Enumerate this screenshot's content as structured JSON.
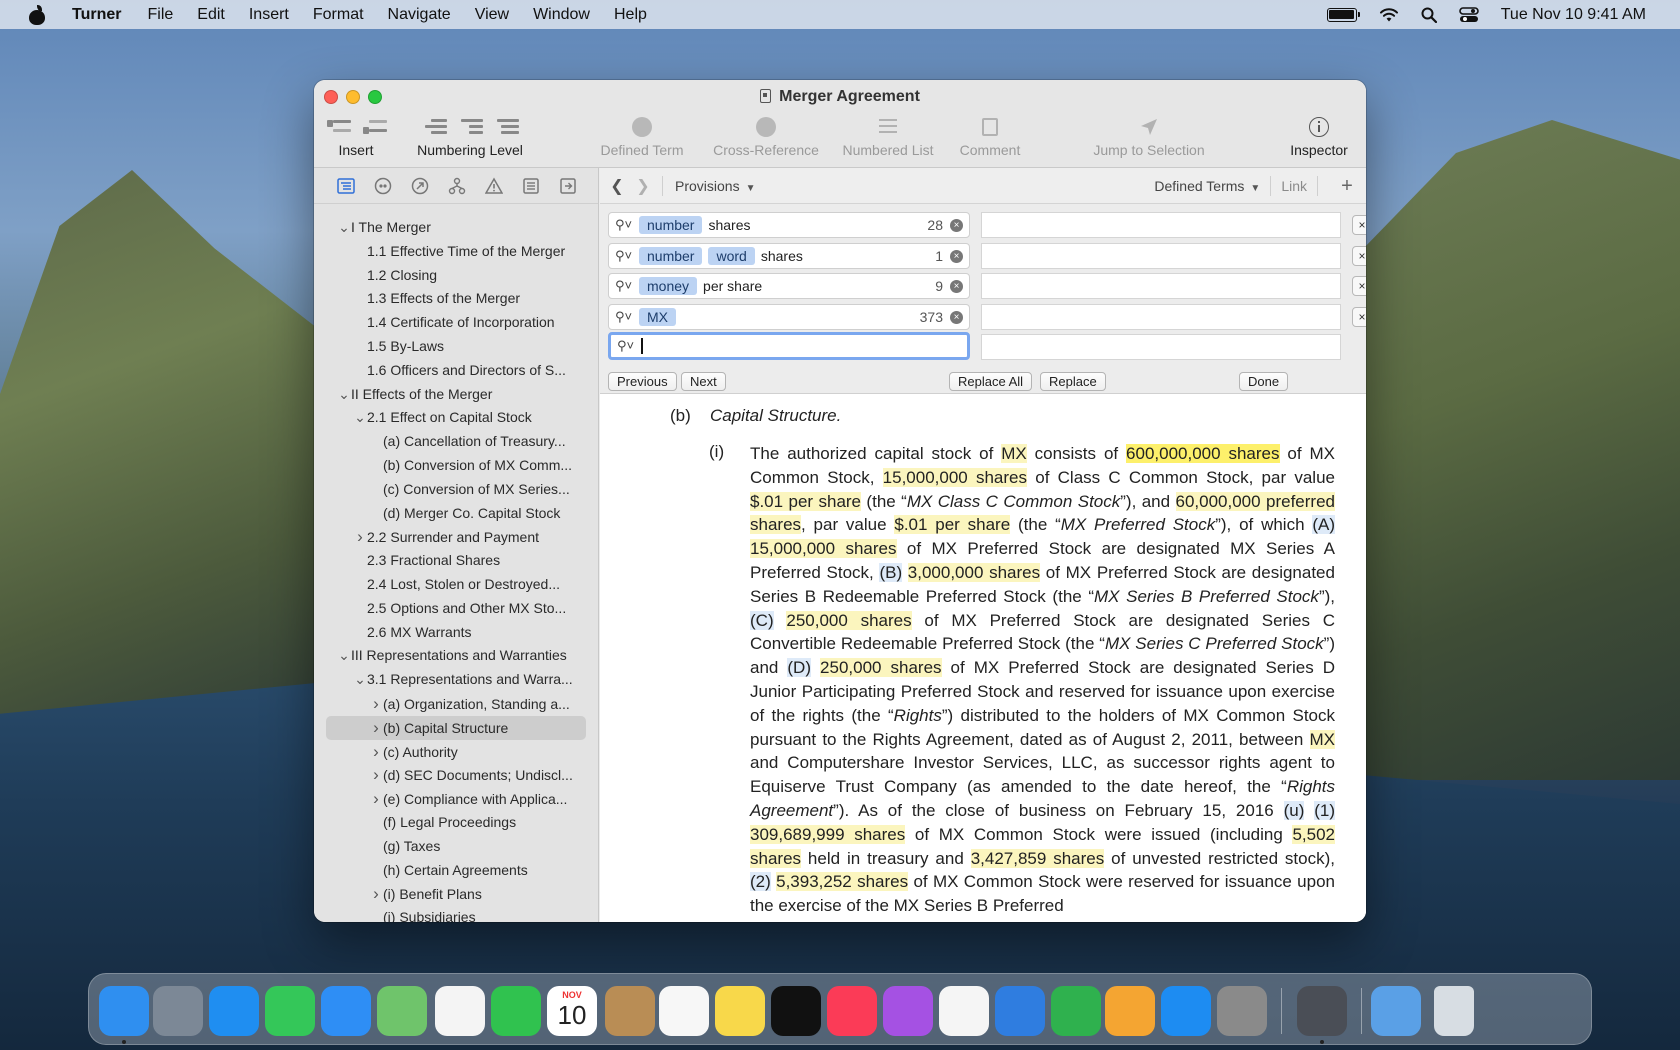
{
  "menubar": {
    "app_name": "Turner",
    "items": [
      "File",
      "Edit",
      "Insert",
      "Format",
      "Navigate",
      "View",
      "Window",
      "Help"
    ],
    "clock": "Tue Nov 10  9:41 AM"
  },
  "window": {
    "title": "Merger Agreement"
  },
  "toolbar": {
    "insert": "Insert",
    "numbering_level": "Numbering Level",
    "defined_term": "Defined Term",
    "cross_reference": "Cross-Reference",
    "numbered_list": "Numbered List",
    "comment": "Comment",
    "jump_to_selection": "Jump to Selection",
    "inspector": "Inspector"
  },
  "outline": [
    {
      "label": "I The Merger",
      "indent": 0,
      "disclosure": "open"
    },
    {
      "label": "1.1 Effective Time of the Merger",
      "indent": 1,
      "disclosure": "none"
    },
    {
      "label": "1.2 Closing",
      "indent": 1,
      "disclosure": "none"
    },
    {
      "label": "1.3 Effects of the Merger",
      "indent": 1,
      "disclosure": "none"
    },
    {
      "label": "1.4 Certificate of Incorporation",
      "indent": 1,
      "disclosure": "none"
    },
    {
      "label": "1.5 By-Laws",
      "indent": 1,
      "disclosure": "none"
    },
    {
      "label": "1.6 Officers and Directors of S...",
      "indent": 1,
      "disclosure": "none"
    },
    {
      "label": "II Effects of the Merger",
      "indent": 0,
      "disclosure": "open"
    },
    {
      "label": "2.1 Effect on Capital Stock",
      "indent": 1,
      "disclosure": "open"
    },
    {
      "label": "(a) Cancellation of Treasury...",
      "indent": 2,
      "disclosure": "none"
    },
    {
      "label": "(b) Conversion of MX Comm...",
      "indent": 2,
      "disclosure": "none"
    },
    {
      "label": "(c) Conversion of MX Series...",
      "indent": 2,
      "disclosure": "none"
    },
    {
      "label": "(d) Merger Co. Capital Stock",
      "indent": 2,
      "disclosure": "none"
    },
    {
      "label": "2.2 Surrender and Payment",
      "indent": 1,
      "disclosure": "closed"
    },
    {
      "label": "2.3 Fractional Shares",
      "indent": 1,
      "disclosure": "none"
    },
    {
      "label": "2.4 Lost, Stolen or Destroyed...",
      "indent": 1,
      "disclosure": "none"
    },
    {
      "label": "2.5 Options and Other MX Sto...",
      "indent": 1,
      "disclosure": "none"
    },
    {
      "label": "2.6 MX Warrants",
      "indent": 1,
      "disclosure": "none"
    },
    {
      "label": "III Representations and Warranties",
      "indent": 0,
      "disclosure": "open"
    },
    {
      "label": "3.1 Representations and Warra...",
      "indent": 1,
      "disclosure": "open"
    },
    {
      "label": "(a) Organization, Standing a...",
      "indent": 2,
      "disclosure": "closed"
    },
    {
      "label": "(b) Capital Structure",
      "indent": 2,
      "disclosure": "closed",
      "selected": true
    },
    {
      "label": "(c) Authority",
      "indent": 2,
      "disclosure": "closed"
    },
    {
      "label": "(d) SEC Documents; Undiscl...",
      "indent": 2,
      "disclosure": "closed"
    },
    {
      "label": "(e) Compliance with Applica...",
      "indent": 2,
      "disclosure": "closed"
    },
    {
      "label": "(f) Legal Proceedings",
      "indent": 2,
      "disclosure": "none"
    },
    {
      "label": "(g) Taxes",
      "indent": 2,
      "disclosure": "none"
    },
    {
      "label": "(h) Certain Agreements",
      "indent": 2,
      "disclosure": "none"
    },
    {
      "label": "(i) Benefit Plans",
      "indent": 2,
      "disclosure": "closed"
    },
    {
      "label": "(j) Subsidiaries",
      "indent": 2,
      "disclosure": "none"
    }
  ],
  "navbar": {
    "provisions": "Provisions",
    "defined_terms": "Defined Terms",
    "link": "Link"
  },
  "find": {
    "rows": [
      {
        "tokens": [
          "number"
        ],
        "text": "shares",
        "count": "28"
      },
      {
        "tokens": [
          "number",
          "word"
        ],
        "text": "shares",
        "count": "1"
      },
      {
        "tokens": [
          "money"
        ],
        "text": "per share",
        "count": "9"
      },
      {
        "tokens": [
          "MX"
        ],
        "text": "",
        "count": "373"
      }
    ],
    "buttons": {
      "previous": "Previous",
      "next": "Next",
      "replace_all": "Replace All",
      "replace": "Replace",
      "done": "Done"
    }
  },
  "document": {
    "heading_num": "(b)",
    "heading_title": "Capital Structure.",
    "para_num": "(i)",
    "text": [
      [
        "t",
        "The authorized capital stock of "
      ],
      [
        "m",
        "MX"
      ],
      [
        "t",
        " consists of "
      ],
      [
        "S",
        "600,000,000 shares"
      ],
      [
        "t",
        " of MX Common Stock, "
      ],
      [
        "s",
        "15,000,000 shares"
      ],
      [
        "t",
        " of Class C Common Stock, par value "
      ],
      [
        "s",
        "$.01 per share"
      ],
      [
        "t",
        " (the “"
      ],
      [
        "i",
        "MX Class C Common Stock"
      ],
      [
        "t",
        "”), and "
      ],
      [
        "s",
        "60,000,000 preferred shares"
      ],
      [
        "t",
        ", par value "
      ],
      [
        "s",
        "$.01 per share"
      ],
      [
        "t",
        " (the “"
      ],
      [
        "i",
        "MX Preferred Stock"
      ],
      [
        "t",
        "”), of which "
      ],
      [
        "r",
        "(A)"
      ],
      [
        "t",
        " "
      ],
      [
        "s",
        "15,000,000 shares"
      ],
      [
        "t",
        " of MX Preferred Stock are designated MX Series A Preferred Stock, "
      ],
      [
        "r",
        "(B)"
      ],
      [
        "t",
        " "
      ],
      [
        "s",
        "3,000,000 shares"
      ],
      [
        "t",
        " of MX Preferred Stock are designated Series B Redeemable Preferred Stock (the “"
      ],
      [
        "i",
        "MX Series B Preferred Stock"
      ],
      [
        "t",
        "”), "
      ],
      [
        "r",
        "(C)"
      ],
      [
        "t",
        " "
      ],
      [
        "s",
        "250,000 shares"
      ],
      [
        "t",
        " of MX Preferred Stock are designated Series C Convertible Redeemable Preferred Stock (the “"
      ],
      [
        "i",
        "MX Series C Preferred Stock"
      ],
      [
        "t",
        "”) and "
      ],
      [
        "r",
        "(D)"
      ],
      [
        "t",
        " "
      ],
      [
        "s",
        "250,000 shares"
      ],
      [
        "t",
        " of MX Preferred Stock are designated Series D Junior Participating Preferred Stock and reserved for issuance upon exercise of the rights (the “"
      ],
      [
        "i",
        "Rights"
      ],
      [
        "t",
        "”) distributed to the holders of MX Common Stock pursuant to the Rights Agreement, dated as of August 2, 2011, between "
      ],
      [
        "m",
        "MX"
      ],
      [
        "t",
        " and Computershare Investor Services, LLC, as successor rights agent to Equiserve Trust Company (as amended to the date hereof, the “"
      ],
      [
        "i",
        "Rights Agreement"
      ],
      [
        "t",
        "”). As of the close of business on February 15, 2016 "
      ],
      [
        "r",
        "(u)"
      ],
      [
        "t",
        " "
      ],
      [
        "r",
        "(1)"
      ],
      [
        "t",
        " "
      ],
      [
        "s",
        "309,689,999 shares"
      ],
      [
        "t",
        " of MX Common Stock were issued (including "
      ],
      [
        "s",
        "5,502 shares"
      ],
      [
        "t",
        " held in treasury and "
      ],
      [
        "s",
        "3,427,859 shares"
      ],
      [
        "t",
        " of unvested restricted stock), "
      ],
      [
        "r",
        "(2)"
      ],
      [
        "t",
        " "
      ],
      [
        "s",
        "5,393,252 shares"
      ],
      [
        "t",
        " of MX Common Stock were reserved for issuance upon the exercise of the MX Series B Preferred"
      ]
    ]
  },
  "dock": {
    "calendar_month": "NOV",
    "calendar_day": "10",
    "apps": [
      "finder-icon",
      "launchpad-icon",
      "safari-icon",
      "messages-icon",
      "mail-icon",
      "maps-icon",
      "photos-icon",
      "facetime-icon",
      "calendar-icon",
      "contacts-icon",
      "reminders-icon",
      "notes-icon",
      "tv-icon",
      "music-icon",
      "podcasts-icon",
      "news-icon",
      "keynote-icon",
      "numbers-icon",
      "pages-icon",
      "app-store-icon",
      "system-preferences-icon",
      "turner-app-icon",
      "downloads-folder-icon",
      "trash-icon"
    ],
    "app_colors": [
      "#2f8ff0",
      "#7c8896",
      "#1f8ef1",
      "#34c759",
      "#2e8ef5",
      "#6fc46b",
      "#f4f4f4",
      "#30c24f",
      "#ffffff",
      "#b98d55",
      "#f7f7f7",
      "#f8d84a",
      "#111111",
      "#fb3b57",
      "#a551e3",
      "#f5f5f5",
      "#2f7de0",
      "#2fb14e",
      "#f4a532",
      "#1d8cf2",
      "#8a8a8a",
      "#4a4e56",
      "#5aa0e6",
      "#d7dde3"
    ]
  },
  "colors": {
    "accent": "#2f6fd8",
    "token": "#bcd3f3",
    "share_highlight": "#fbf5be",
    "share_highlight_strong": "#fdf06b",
    "ref_highlight": "#deeaf8"
  }
}
